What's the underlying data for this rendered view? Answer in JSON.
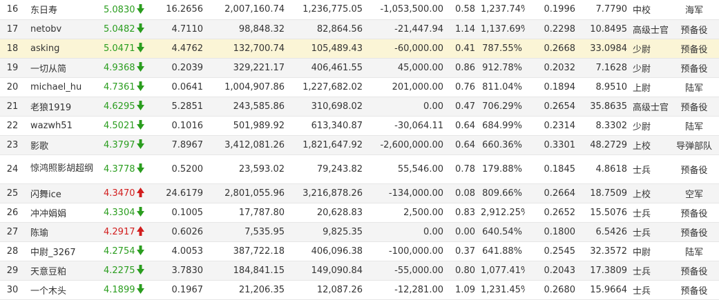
{
  "colors": {
    "down": "#2a9d1e",
    "up": "#d21e1e",
    "highlight_row": "#fbf5d6"
  },
  "rows": [
    {
      "rank": "16",
      "name": "东日寿",
      "score": "5.0830",
      "trend": "down",
      "c1": "16.2656",
      "c2": "2,007,160.74",
      "c3": "1,236,775.05",
      "c4": "-1,053,500.00",
      "c5": "0.58",
      "c6": "1,237.74%",
      "c7": "0.1996",
      "c8": "7.7790",
      "title": "中校",
      "branch": "海军"
    },
    {
      "rank": "17",
      "name": "netobv",
      "score": "5.0482",
      "trend": "down",
      "c1": "4.7110",
      "c2": "98,848.32",
      "c3": "82,864.56",
      "c4": "-21,447.94",
      "c5": "1.14",
      "c6": "1,137.69%",
      "c7": "0.2298",
      "c8": "10.8495",
      "title": "高级士官",
      "branch": "预备役"
    },
    {
      "rank": "18",
      "name": "asking",
      "score": "5.0471",
      "trend": "down",
      "c1": "4.4762",
      "c2": "132,700.74",
      "c3": "105,489.43",
      "c4": "-60,000.00",
      "c5": "0.41",
      "c6": "787.55%",
      "c7": "0.2668",
      "c8": "33.0984",
      "title": "少尉",
      "branch": "预备役",
      "highlight": true
    },
    {
      "rank": "19",
      "name": "一切从简",
      "score": "4.9368",
      "trend": "down",
      "c1": "0.2039",
      "c2": "329,221.17",
      "c3": "406,461.55",
      "c4": "45,000.00",
      "c5": "0.86",
      "c6": "912.78%",
      "c7": "0.2032",
      "c8": "7.1628",
      "title": "少尉",
      "branch": "预备役"
    },
    {
      "rank": "20",
      "name": "michael_hu",
      "score": "4.7361",
      "trend": "down",
      "c1": "0.0641",
      "c2": "1,004,907.86",
      "c3": "1,227,682.02",
      "c4": "201,000.00",
      "c5": "0.76",
      "c6": "811.04%",
      "c7": "0.1894",
      "c8": "8.9510",
      "title": "上尉",
      "branch": "陆军"
    },
    {
      "rank": "21",
      "name": "老狼1919",
      "score": "4.6295",
      "trend": "down",
      "c1": "5.2851",
      "c2": "243,585.86",
      "c3": "310,698.02",
      "c4": "0.00",
      "c5": "0.47",
      "c6": "706.29%",
      "c7": "0.2654",
      "c8": "35.8635",
      "title": "高级士官",
      "branch": "预备役"
    },
    {
      "rank": "22",
      "name": "wazwh51",
      "score": "4.5021",
      "trend": "down",
      "c1": "0.1016",
      "c2": "501,989.92",
      "c3": "613,340.87",
      "c4": "-30,064.11",
      "c5": "0.64",
      "c6": "684.99%",
      "c7": "0.2314",
      "c8": "8.3302",
      "title": "少尉",
      "branch": "陆军"
    },
    {
      "rank": "23",
      "name": "影歌",
      "score": "4.3797",
      "trend": "down",
      "c1": "7.8967",
      "c2": "3,412,081.26",
      "c3": "1,821,647.92",
      "c4": "-2,600,000.00",
      "c5": "0.64",
      "c6": "660.36%",
      "c7": "0.3301",
      "c8": "48.2729",
      "title": "上校",
      "branch": "导弹部队"
    },
    {
      "rank": "24",
      "name": "惊鸿照影胡超纲",
      "score": "4.3778",
      "trend": "down",
      "c1": "0.5200",
      "c2": "23,593.02",
      "c3": "79,243.82",
      "c4": "55,546.00",
      "c5": "0.78",
      "c6": "179.88%",
      "c7": "0.1845",
      "c8": "4.8618",
      "title": "士兵",
      "branch": "预备役",
      "tall": true
    },
    {
      "rank": "25",
      "name": "闪舞ice",
      "score": "4.3470",
      "trend": "up",
      "c1": "24.6179",
      "c2": "2,801,055.96",
      "c3": "3,216,878.26",
      "c4": "-134,000.00",
      "c5": "0.08",
      "c6": "809.66%",
      "c7": "0.2664",
      "c8": "18.7509",
      "title": "上校",
      "branch": "空军"
    },
    {
      "rank": "26",
      "name": "冲冲娟娟",
      "score": "4.3304",
      "trend": "down",
      "c1": "0.1005",
      "c2": "17,787.80",
      "c3": "20,628.83",
      "c4": "2,500.00",
      "c5": "0.83",
      "c6": "2,912.25%",
      "c7": "0.2652",
      "c8": "15.5076",
      "title": "士兵",
      "branch": "预备役"
    },
    {
      "rank": "27",
      "name": "陈瑜",
      "score": "4.2917",
      "trend": "up",
      "c1": "0.6026",
      "c2": "7,535.95",
      "c3": "9,825.35",
      "c4": "0.00",
      "c5": "0.00",
      "c6": "640.54%",
      "c7": "0.1800",
      "c8": "6.5426",
      "title": "士兵",
      "branch": "预备役"
    },
    {
      "rank": "28",
      "name": "中尉_3267",
      "score": "4.2754",
      "trend": "down",
      "c1": "4.0053",
      "c2": "387,722.18",
      "c3": "406,096.38",
      "c4": "-100,000.00",
      "c5": "0.37",
      "c6": "641.88%",
      "c7": "0.2545",
      "c8": "32.3572",
      "title": "中尉",
      "branch": "陆军"
    },
    {
      "rank": "29",
      "name": "天意豆粕",
      "score": "4.2275",
      "trend": "down",
      "c1": "3.7830",
      "c2": "184,841.15",
      "c3": "149,090.84",
      "c4": "-55,000.00",
      "c5": "0.80",
      "c6": "1,077.41%",
      "c7": "0.2043",
      "c8": "17.3809",
      "title": "士兵",
      "branch": "预备役"
    },
    {
      "rank": "30",
      "name": "一个木头",
      "score": "4.1899",
      "trend": "down",
      "c1": "0.1967",
      "c2": "21,206.35",
      "c3": "12,087.26",
      "c4": "-12,281.00",
      "c5": "1.09",
      "c6": "1,231.45%",
      "c7": "0.2680",
      "c8": "15.9664",
      "title": "士兵",
      "branch": "预备役"
    }
  ]
}
